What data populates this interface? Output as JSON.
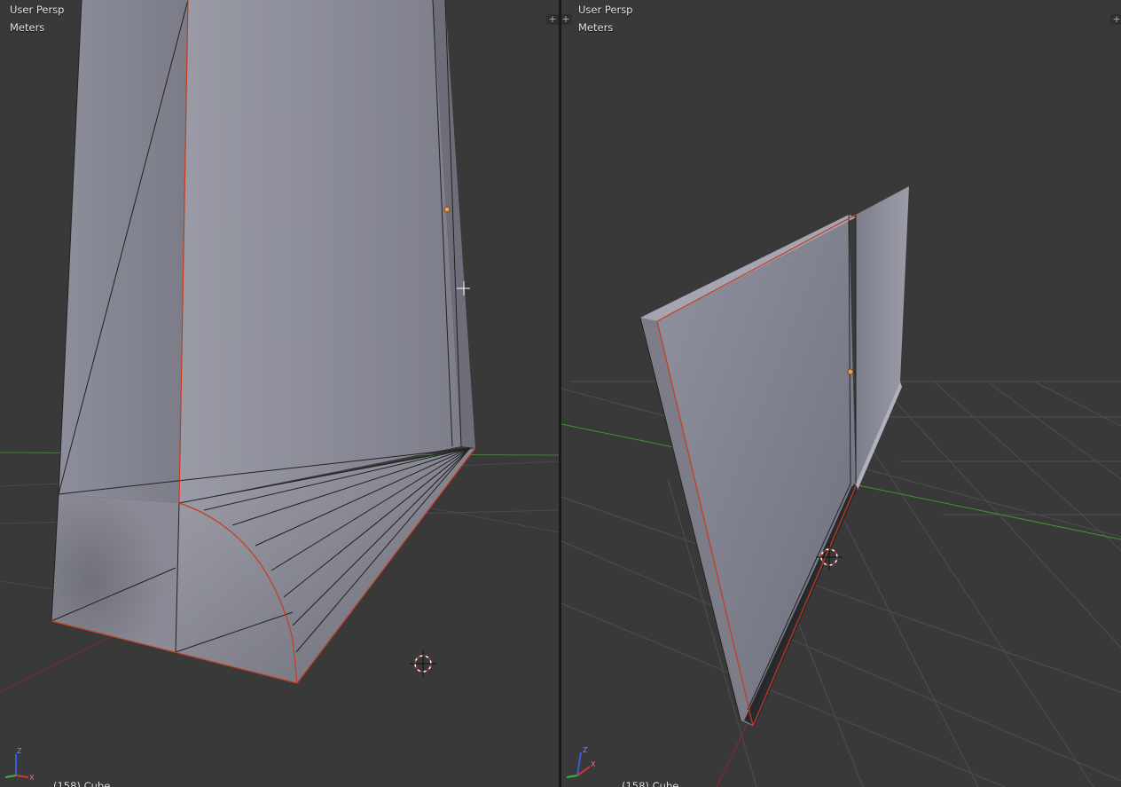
{
  "viewports": [
    {
      "id": "left",
      "view_label": "User Persp",
      "units_label": "Meters",
      "status_text": "(158) Cube",
      "gizmo": {
        "x": "X",
        "y": "Y",
        "z": "Z"
      }
    },
    {
      "id": "right",
      "view_label": "User Persp",
      "units_label": "Meters",
      "status_text": "(158) Cube",
      "gizmo": {
        "x": "X",
        "y": "Y",
        "z": "Z"
      }
    }
  ],
  "colors": {
    "viewport_bg": "#393939",
    "grid_line": "#4a4a4a",
    "x_axis": "#8a2a2a",
    "y_axis": "#3a8a2a",
    "mesh_face": "#8a8b98",
    "selected_edge": "#c83a1e",
    "origin_dot": "#f0a050"
  },
  "icons": [
    "split-corner-icon",
    "3d-cursor-icon",
    "mouse-crosshair-icon",
    "axis-gizmo-icon",
    "object-origin-icon"
  ]
}
